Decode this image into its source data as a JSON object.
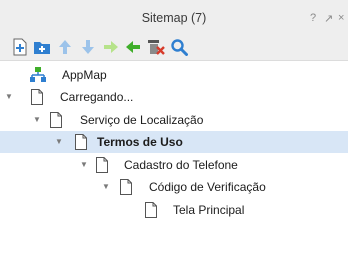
{
  "panel": {
    "title": "Sitemap (7)",
    "title_controls": {
      "help": "?",
      "expand": "↗",
      "close": "×"
    }
  },
  "toolbar": {
    "buttons": [
      {
        "name": "add-page-button",
        "icon": "add-page-icon",
        "color": "#2f7fd0"
      },
      {
        "name": "add-folder-button",
        "icon": "add-folder-icon",
        "color": "#2f7fd0"
      },
      {
        "name": "move-up-button",
        "icon": "arrow-up-icon",
        "color": "#9cc3ea",
        "enabled": false
      },
      {
        "name": "move-down-button",
        "icon": "arrow-down-icon",
        "color": "#9cc3ea",
        "enabled": false
      },
      {
        "name": "indent-button",
        "icon": "arrow-right-icon",
        "color": "#b6e38a",
        "enabled": false
      },
      {
        "name": "outdent-button",
        "icon": "arrow-left-icon",
        "color": "#3fae2a",
        "enabled": true
      },
      {
        "name": "delete-page-button",
        "icon": "delete-page-icon",
        "color": "#d63a2a",
        "enabled": true
      },
      {
        "name": "search-button",
        "icon": "search-icon",
        "color": "#2f7fd0",
        "enabled": true
      }
    ]
  },
  "tree": {
    "root": {
      "label": "AppMap",
      "icon": "sitemap-icon",
      "color": "#3fae2a"
    },
    "nodes": [
      {
        "label": "Carregando...",
        "expanded": true
      },
      {
        "label": "Serviço de Localização",
        "expanded": true
      },
      {
        "label": "Termos de Uso",
        "expanded": true,
        "selected": true
      },
      {
        "label": "Cadastro do Telefone",
        "expanded": true
      },
      {
        "label": "Código de Verificação",
        "expanded": true
      },
      {
        "label": "Tela Principal",
        "expanded": false
      }
    ],
    "selection_color": "#d8e6f6"
  }
}
